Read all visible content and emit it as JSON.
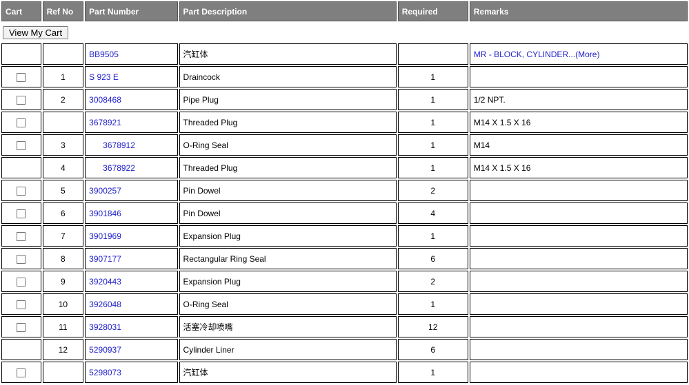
{
  "headers": {
    "cart": "Cart",
    "ref_no": "Ref No",
    "part_number": "Part Number",
    "part_description": "Part Description",
    "required": "Required",
    "remarks": "Remarks"
  },
  "view_cart_label": "View My Cart",
  "rows": [
    {
      "cart": false,
      "ref": "",
      "part": "BB9505",
      "desc": "汽缸体",
      "required": "",
      "remarks": "MR - BLOCK, CYLINDER...(More)",
      "remarks_link": true,
      "indent": false
    },
    {
      "cart": true,
      "ref": "1",
      "part": "S 923 E",
      "desc": "Draincock",
      "required": "1",
      "remarks": "",
      "remarks_link": false,
      "indent": false
    },
    {
      "cart": true,
      "ref": "2",
      "part": "3008468",
      "desc": "Pipe Plug",
      "required": "1",
      "remarks": "1/2 NPT.",
      "remarks_link": false,
      "indent": false
    },
    {
      "cart": true,
      "ref": "",
      "part": "3678921",
      "desc": "Threaded Plug",
      "required": "1",
      "remarks": "M14 X 1.5 X 16",
      "remarks_link": false,
      "indent": false
    },
    {
      "cart": true,
      "ref": "3",
      "part": "3678912",
      "desc": "O-Ring Seal",
      "required": "1",
      "remarks": "M14",
      "remarks_link": false,
      "indent": true
    },
    {
      "cart": false,
      "ref": "4",
      "part": "3678922",
      "desc": "Threaded Plug",
      "required": "1",
      "remarks": "M14 X 1.5 X 16",
      "remarks_link": false,
      "indent": true
    },
    {
      "cart": true,
      "ref": "5",
      "part": "3900257",
      "desc": "Pin Dowel",
      "required": "2",
      "remarks": "",
      "remarks_link": false,
      "indent": false
    },
    {
      "cart": true,
      "ref": "6",
      "part": "3901846",
      "desc": "Pin Dowel",
      "required": "4",
      "remarks": "",
      "remarks_link": false,
      "indent": false
    },
    {
      "cart": true,
      "ref": "7",
      "part": "3901969",
      "desc": "Expansion Plug",
      "required": "1",
      "remarks": "",
      "remarks_link": false,
      "indent": false
    },
    {
      "cart": true,
      "ref": "8",
      "part": "3907177",
      "desc": "Rectangular Ring Seal",
      "required": "6",
      "remarks": "",
      "remarks_link": false,
      "indent": false
    },
    {
      "cart": true,
      "ref": "9",
      "part": "3920443",
      "desc": "Expansion Plug",
      "required": "2",
      "remarks": "",
      "remarks_link": false,
      "indent": false
    },
    {
      "cart": true,
      "ref": "10",
      "part": "3926048",
      "desc": "O-Ring Seal",
      "required": "1",
      "remarks": "",
      "remarks_link": false,
      "indent": false
    },
    {
      "cart": true,
      "ref": "11",
      "part": "3928031",
      "desc": "活塞冷却喷嘴",
      "required": "12",
      "remarks": "",
      "remarks_link": false,
      "indent": false
    },
    {
      "cart": false,
      "ref": "12",
      "part": "5290937",
      "desc": "Cylinder Liner",
      "required": "6",
      "remarks": "",
      "remarks_link": false,
      "indent": false
    },
    {
      "cart": true,
      "ref": "",
      "part": "5298073",
      "desc": "汽缸体",
      "required": "1",
      "remarks": "",
      "remarks_link": false,
      "indent": false
    }
  ]
}
